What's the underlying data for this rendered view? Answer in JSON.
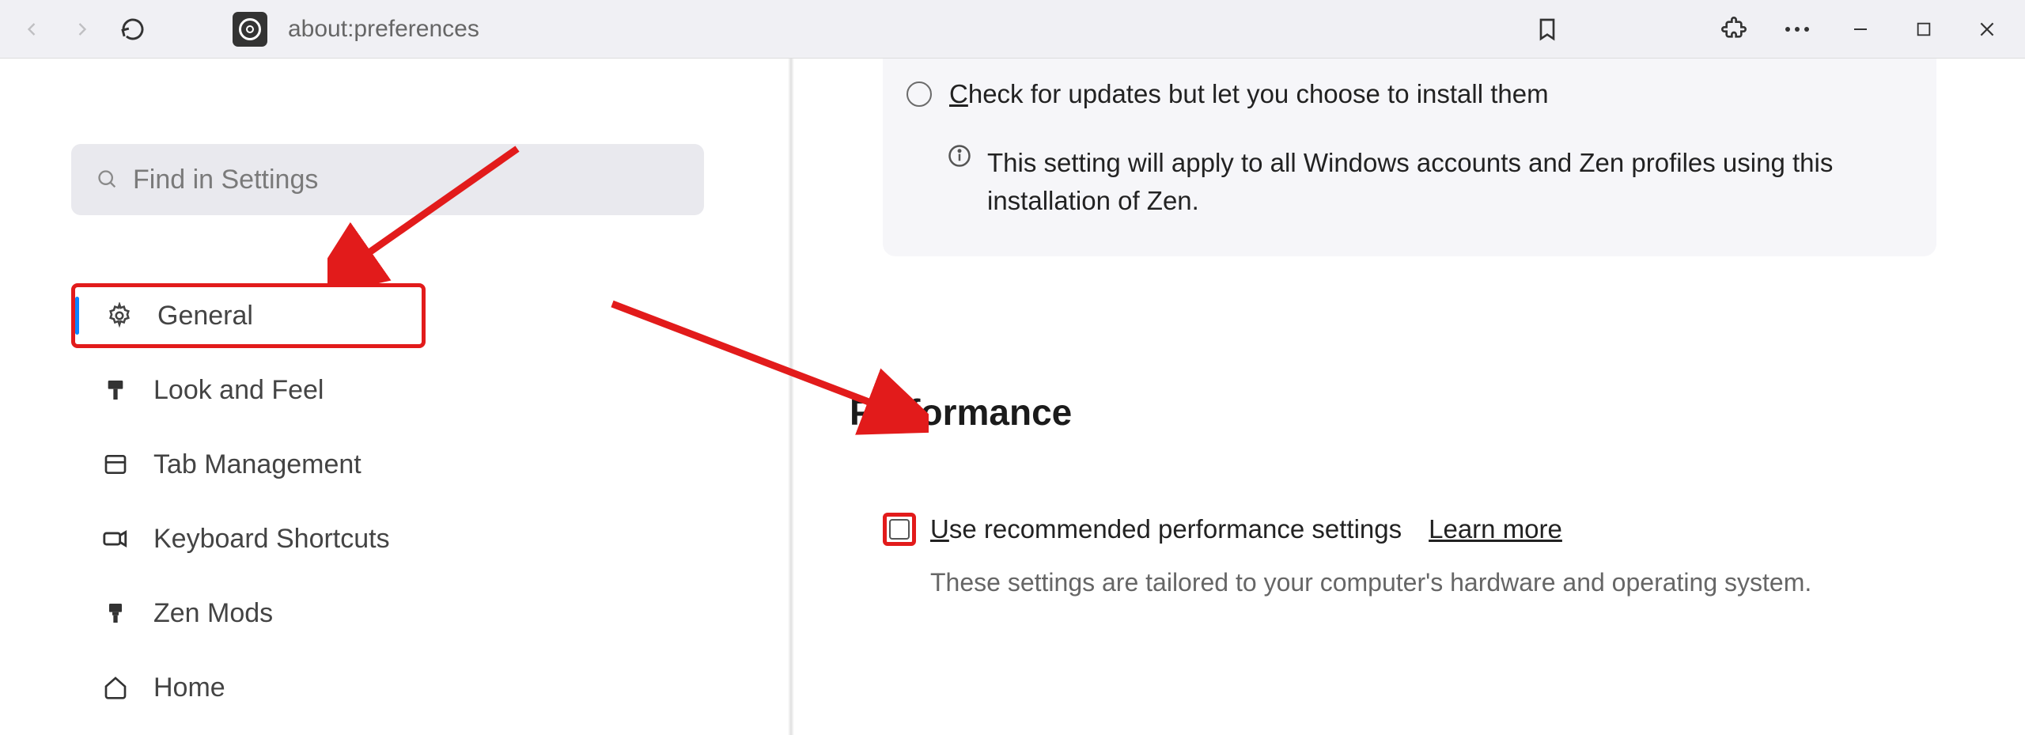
{
  "url": "about:preferences",
  "search": {
    "placeholder": "Find in Settings"
  },
  "sidebar": {
    "items": [
      {
        "label": "General"
      },
      {
        "label": "Look and Feel"
      },
      {
        "label": "Tab Management"
      },
      {
        "label": "Keyboard Shortcuts"
      },
      {
        "label": "Zen Mods"
      },
      {
        "label": "Home"
      }
    ]
  },
  "updates": {
    "radio_label": "Check for updates but let you choose to install them",
    "info_text": "This setting will apply to all Windows accounts and Zen profiles using this installation of Zen."
  },
  "performance": {
    "section_title": "Performance",
    "checkbox_label": "Use recommended performance settings",
    "learn_more": "Learn more",
    "description": "These settings are tailored to your computer's hardware and operating system."
  }
}
